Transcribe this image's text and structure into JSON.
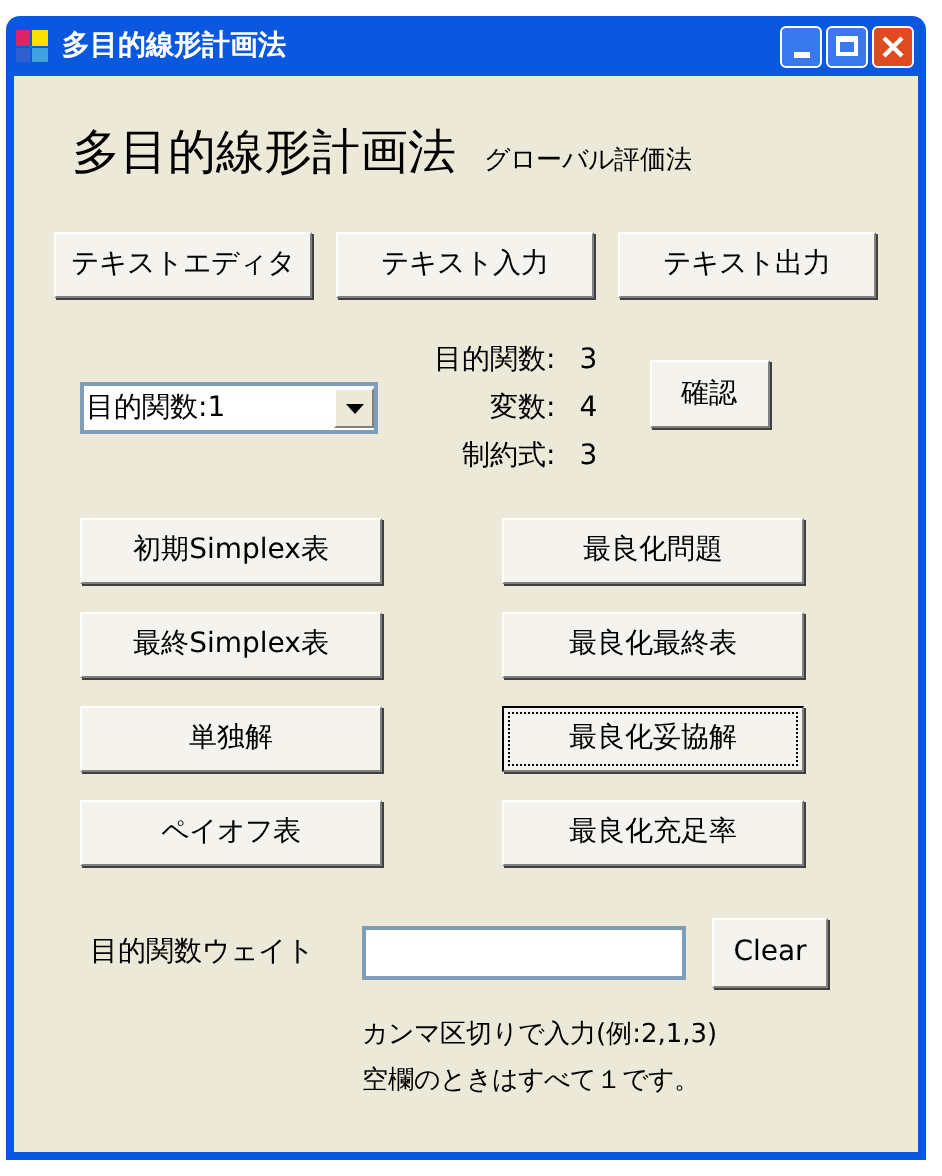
{
  "window": {
    "title": "多目的線形計画法"
  },
  "heading": "多目的線形計画法",
  "subheading": "グローバル評価法",
  "top_buttons": [
    "テキストエディタ",
    "テキスト入力",
    "テキスト出力"
  ],
  "objective_select": {
    "value": "目的関数:1"
  },
  "counts": [
    {
      "label": "目的関数:",
      "value": "3"
    },
    {
      "label": "変数:",
      "value": "4"
    },
    {
      "label": "制約式:",
      "value": "3"
    }
  ],
  "confirm_button": "確認",
  "buttons": [
    {
      "label": "初期Simplex表",
      "focused": false
    },
    {
      "label": "最良化問題",
      "focused": false
    },
    {
      "label": "最終Simplex表",
      "focused": false
    },
    {
      "label": "最良化最終表",
      "focused": false
    },
    {
      "label": "単独解",
      "focused": false
    },
    {
      "label": "最良化妥協解",
      "focused": true
    },
    {
      "label": "ペイオフ表",
      "focused": false
    },
    {
      "label": "最良化充足率",
      "focused": false
    }
  ],
  "weight": {
    "label": "目的関数ウェイト",
    "clear_button": "Clear"
  },
  "notes": [
    "カンマ区切りで入力(例:2,1,3)",
    "空欄のときはすべて１です。"
  ]
}
